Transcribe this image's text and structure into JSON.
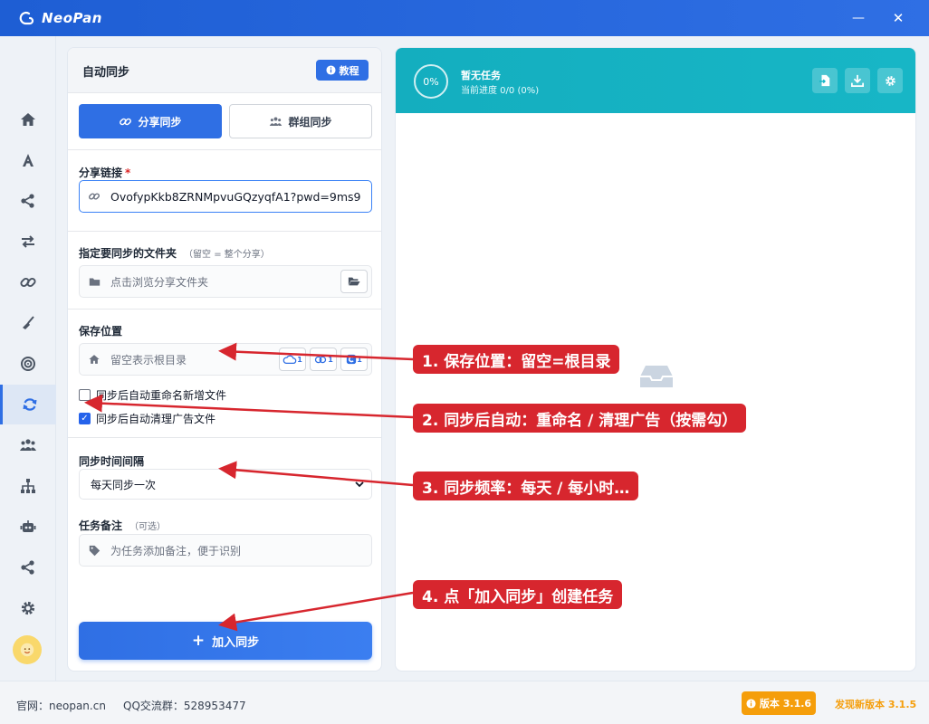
{
  "app": {
    "title": "NeoPan"
  },
  "window": {
    "minimize": "—",
    "close": "✕"
  },
  "sidebar": {
    "items": [
      {
        "name": "home"
      },
      {
        "name": "font"
      },
      {
        "name": "share"
      },
      {
        "name": "transfer"
      },
      {
        "name": "link"
      },
      {
        "name": "clean"
      },
      {
        "name": "target"
      },
      {
        "name": "sync"
      },
      {
        "name": "group"
      },
      {
        "name": "sitemap"
      },
      {
        "name": "robot"
      },
      {
        "name": "share-alt"
      },
      {
        "name": "settings"
      }
    ],
    "active": "sync"
  },
  "panel": {
    "title": "自动同步",
    "tutorial": "教程",
    "tabs": [
      {
        "label": "分享同步"
      },
      {
        "label": "群组同步"
      }
    ],
    "share_link": {
      "label": "分享链接",
      "required": "*",
      "value": "OvofypKkb8ZRNMpvuGQzyqfA1?pwd=9ms9"
    },
    "folder": {
      "label": "指定要同步的文件夹",
      "hint": "（留空 = 整个分享）",
      "placeholder": "点击浏览分享文件夹"
    },
    "save": {
      "label": "保存位置",
      "placeholder": "留空表示根目录",
      "badges": [
        "1",
        "1",
        "1"
      ]
    },
    "options": [
      {
        "label": "同步后自动重命名新增文件",
        "checked": false
      },
      {
        "label": "同步后自动清理广告文件",
        "checked": true
      }
    ],
    "interval": {
      "label": "同步时间间隔",
      "value": "每天同步一次"
    },
    "note": {
      "label": "任务备注",
      "hint": "（可选）",
      "placeholder": "为任务添加备注，便于识别"
    },
    "add_button": "加入同步"
  },
  "task": {
    "progress": "0%",
    "title": "暂无任务",
    "subtitle": "当前进度 0/0 (0%)"
  },
  "footer": {
    "site": "官网：neopan.cn",
    "qq": "QQ交流群：528953477",
    "version": "版本 3.1.6",
    "new_version": "发现新版本 3.1.5"
  },
  "annotations": [
    "1. 保存位置：留空=根目录",
    "2. 同步后自动：重命名 / 清理广告（按需勾）",
    "3. 同步频率：每天 / 每小时…",
    "4. 点「加入同步」创建任务"
  ],
  "colors": {
    "accent": "#2f6fe4",
    "teal": "#17b6c6",
    "annotation": "#d7262e",
    "version": "#f59e0b"
  }
}
